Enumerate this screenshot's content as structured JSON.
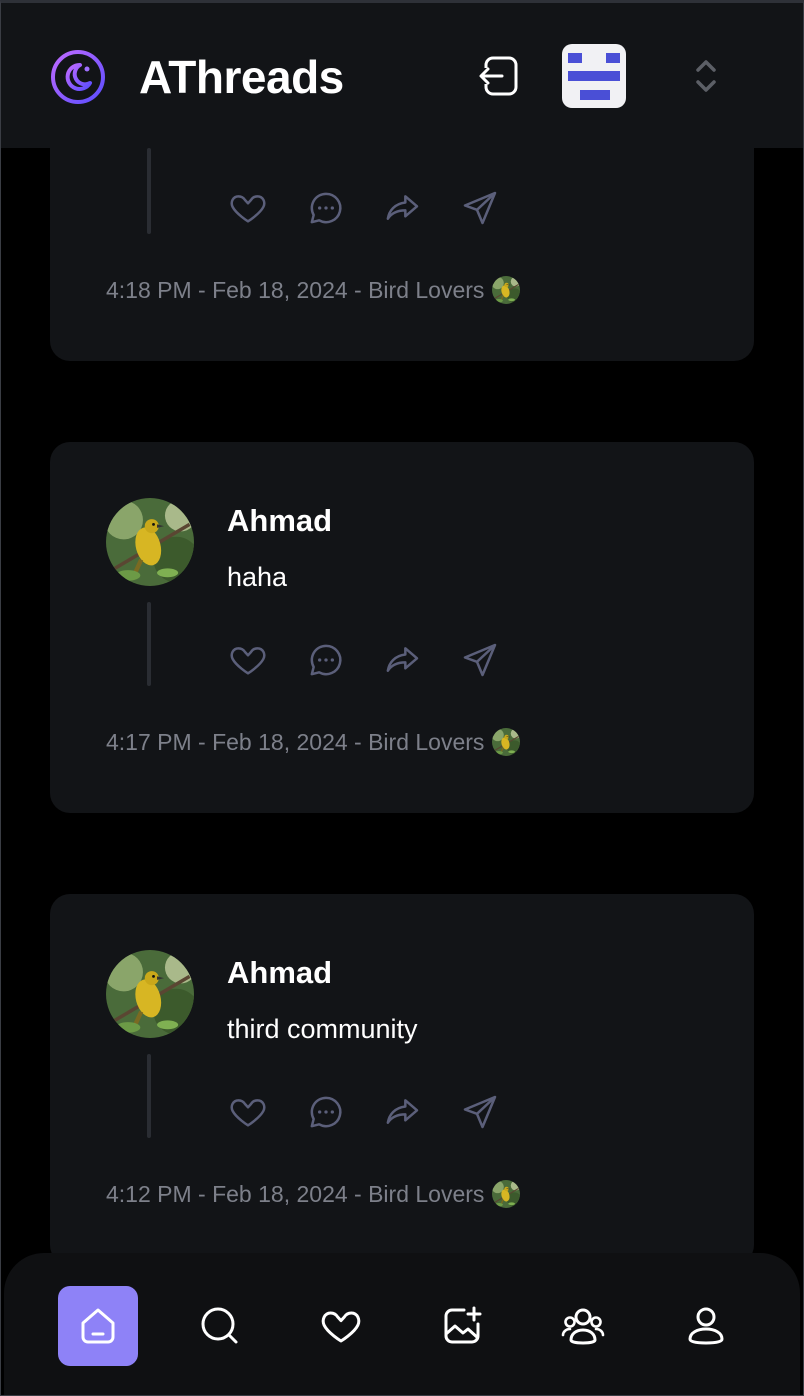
{
  "app": {
    "title": "AThreads"
  },
  "colors": {
    "accent": "#8e82f7",
    "card_bg": "#121417",
    "meta_text": "#7d808a",
    "switcher_bar": "#4a4fd6"
  },
  "header": {
    "logout_icon": "logout-icon",
    "org_switcher_icon": "organization-avatar",
    "chevrons_icon": "chevron-up-down-icon"
  },
  "threads": [
    {
      "author": "",
      "text": "",
      "meta_text": "4:18 PM - Feb 18, 2024 - Bird Lovers",
      "actions": [
        "heart-icon",
        "reply-icon",
        "repost-icon",
        "share-icon"
      ]
    },
    {
      "author": "Ahmad",
      "text": "haha",
      "meta_text": "4:17 PM - Feb 18, 2024 - Bird Lovers",
      "actions": [
        "heart-icon",
        "reply-icon",
        "repost-icon",
        "share-icon"
      ]
    },
    {
      "author": "Ahmad",
      "text": "third community",
      "meta_text": "4:12 PM - Feb 18, 2024 - Bird Lovers",
      "actions": [
        "heart-icon",
        "reply-icon",
        "repost-icon",
        "share-icon"
      ]
    }
  ],
  "bottom_nav": [
    {
      "name": "home",
      "icon": "home-icon",
      "active": true
    },
    {
      "name": "search",
      "icon": "search-icon",
      "active": false
    },
    {
      "name": "activity",
      "icon": "heart-icon",
      "active": false
    },
    {
      "name": "create-thread",
      "icon": "image-add-icon",
      "active": false
    },
    {
      "name": "communities",
      "icon": "users-icon",
      "active": false
    },
    {
      "name": "profile",
      "icon": "user-icon",
      "active": false
    }
  ]
}
